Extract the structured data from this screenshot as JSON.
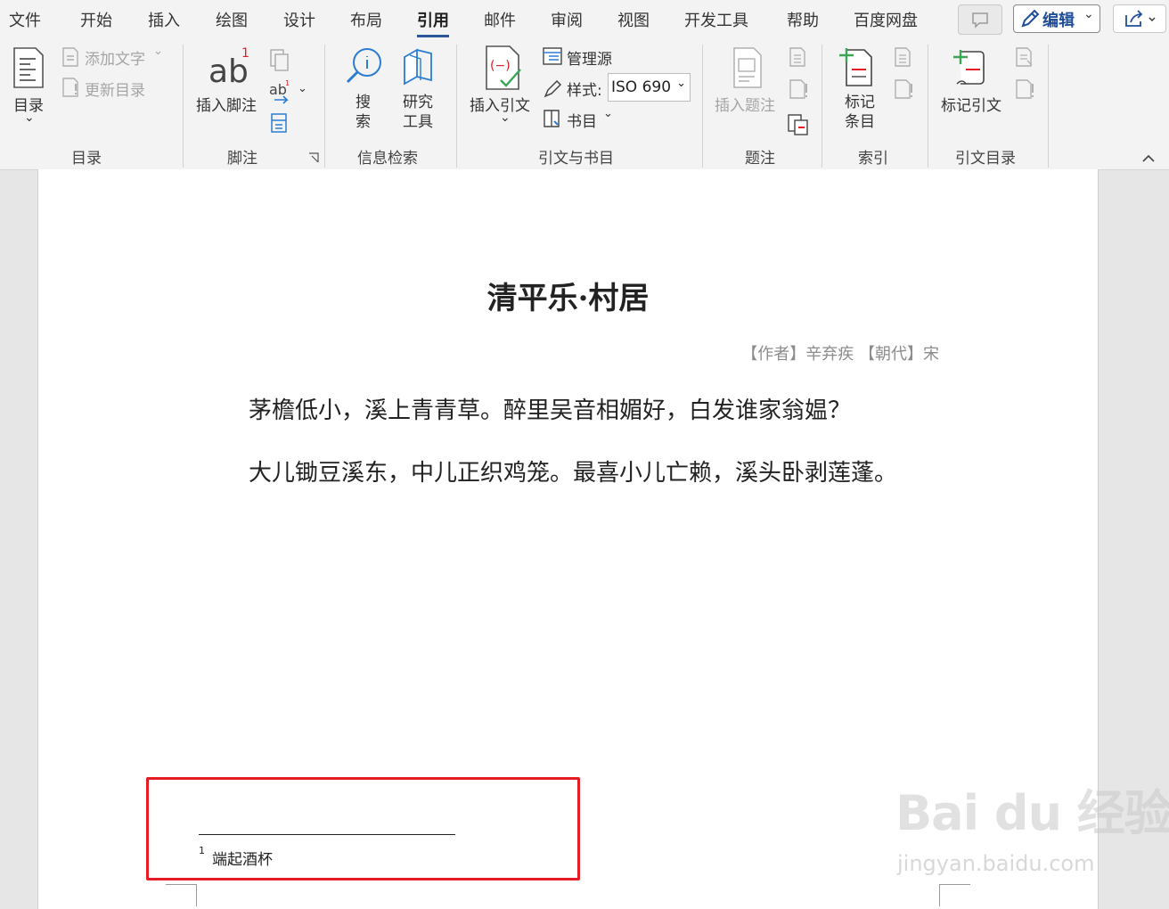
{
  "menu": {
    "tabs": [
      "文件",
      "开始",
      "插入",
      "绘图",
      "设计",
      "布局",
      "引用",
      "邮件",
      "审阅",
      "视图",
      "开发工具",
      "帮助",
      "百度网盘"
    ],
    "active_tab": "引用",
    "edit_label": "编辑"
  },
  "ribbon": {
    "toc": {
      "button": "目录",
      "add_text": "添加文字",
      "update": "更新目录",
      "label": "目录"
    },
    "footnotes": {
      "insert": "插入脚注",
      "label": "脚注"
    },
    "research": {
      "search": "搜索",
      "research_tools": "研究工具",
      "label": "信息检索"
    },
    "citations": {
      "insert": "插入引文",
      "manage": "管理源",
      "style_label": "样式:",
      "style_value": "ISO 690",
      "biblio": "书目",
      "label": "引文与书目"
    },
    "captions": {
      "insert": "插入题注",
      "label": "题注"
    },
    "index": {
      "mark": "标记条目",
      "label": "索引"
    },
    "toa": {
      "mark": "标记引文",
      "label": "引文目录"
    }
  },
  "document": {
    "title": "清平乐·村居",
    "author": "【作者】辛弃疾 【朝代】宋",
    "paragraphs": [
      "茅檐低小，溪上青青草。醉里吴音相媚好，白发谁家翁媪？",
      "大儿锄豆溪东，中儿正织鸡笼。最喜小儿亡赖，溪头卧剥莲蓬。"
    ],
    "footnote_number": "1",
    "footnote_text": "端起酒杯"
  },
  "watermark": {
    "text": "Bai du 经验",
    "url": "jingyan.baidu.com"
  },
  "colors": {
    "accent": "#2b579a",
    "highlight": "#e51c23",
    "ribbon_bg": "#f3f3f3"
  }
}
